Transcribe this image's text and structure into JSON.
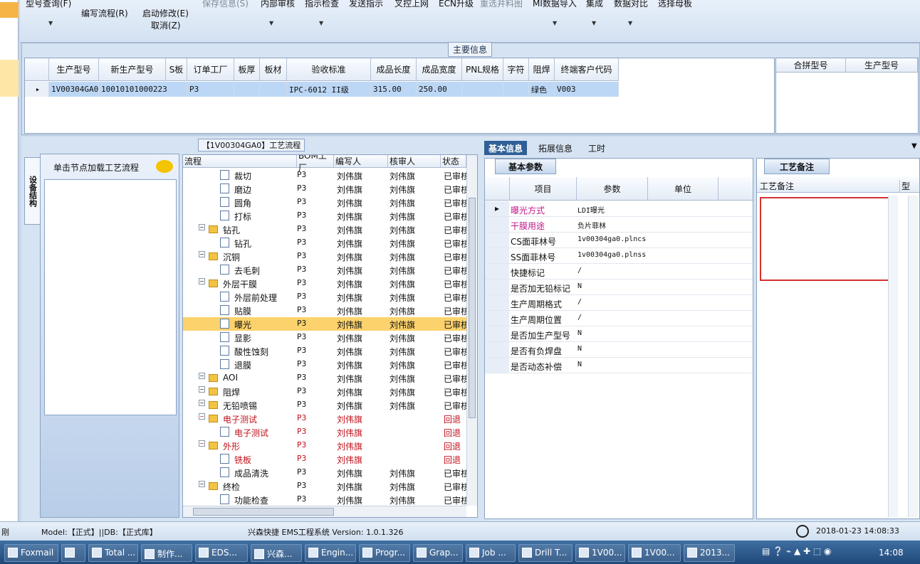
{
  "toolbar": {
    "items": [
      {
        "label": "型号查询(F)",
        "disabled": false
      },
      {
        "label": "编写流程(R)",
        "disabled": false
      },
      {
        "label": "启动修改(E)",
        "disabled": false
      },
      {
        "label": "取消(Z)",
        "disabled": false
      },
      {
        "label": "保存信息(S)",
        "disabled": true
      },
      {
        "label": "内部审核",
        "disabled": false
      },
      {
        "label": "指示检查",
        "disabled": false
      },
      {
        "label": "发送指示",
        "disabled": false
      },
      {
        "label": "叉控上网",
        "disabled": false
      },
      {
        "label": "ECN升级",
        "disabled": false
      },
      {
        "label": "重选并料图",
        "disabled": true
      },
      {
        "label": "MI数据导入",
        "disabled": false
      },
      {
        "label": "集成",
        "disabled": false
      },
      {
        "label": "数据对比",
        "disabled": false
      },
      {
        "label": "选择母板",
        "disabled": false
      }
    ]
  },
  "main_info": {
    "title": "主要信息",
    "columns": [
      "生产型号",
      "新生产型号",
      "S板",
      "订单工厂",
      "板厚",
      "板材",
      "验收标准",
      "成品长度",
      "成品宽度",
      "PNL规格",
      "字符",
      "阻焊",
      "终端客户代码"
    ],
    "row": [
      "1V00304GA0",
      "10010101000223",
      "",
      "P3",
      "",
      "",
      "IPC-6012 II级",
      "315.00",
      "250.00",
      "",
      "",
      "绿色",
      "V003"
    ],
    "merge_columns": [
      "合拼型号",
      "生产型号"
    ]
  },
  "left_panel": {
    "vertical_tab": "设备结构",
    "load_hint": "单击节点加载工艺流程"
  },
  "process": {
    "title": "【1V00304GA0】工艺流程",
    "columns": [
      "流程",
      "BOM工厂",
      "编写人",
      "核审人",
      "状态"
    ],
    "rows": [
      {
        "name": "裁切",
        "level": 2,
        "type": "doc",
        "bom": "P3",
        "writer": "刘伟旗",
        "reviewer": "刘伟旗",
        "status": "已审核",
        "red": false,
        "sel": false
      },
      {
        "name": "磨边",
        "level": 2,
        "type": "doc",
        "bom": "P3",
        "writer": "刘伟旗",
        "reviewer": "刘伟旗",
        "status": "已审核",
        "red": false,
        "sel": false
      },
      {
        "name": "圆角",
        "level": 2,
        "type": "doc",
        "bom": "P3",
        "writer": "刘伟旗",
        "reviewer": "刘伟旗",
        "status": "已审核",
        "red": false,
        "sel": false
      },
      {
        "name": "打标",
        "level": 2,
        "type": "doc",
        "bom": "P3",
        "writer": "刘伟旗",
        "reviewer": "刘伟旗",
        "status": "已审核",
        "red": false,
        "sel": false
      },
      {
        "name": "钻孔",
        "level": 1,
        "type": "fold",
        "bom": "P3",
        "writer": "刘伟旗",
        "reviewer": "刘伟旗",
        "status": "已审核",
        "red": false,
        "sel": false
      },
      {
        "name": "钻孔",
        "level": 2,
        "type": "doc",
        "bom": "P3",
        "writer": "刘伟旗",
        "reviewer": "刘伟旗",
        "status": "已审核",
        "red": false,
        "sel": false
      },
      {
        "name": "沉铜",
        "level": 1,
        "type": "fold",
        "bom": "P3",
        "writer": "刘伟旗",
        "reviewer": "刘伟旗",
        "status": "已审核",
        "red": false,
        "sel": false
      },
      {
        "name": "去毛刺",
        "level": 2,
        "type": "doc",
        "bom": "P3",
        "writer": "刘伟旗",
        "reviewer": "刘伟旗",
        "status": "已审核",
        "red": false,
        "sel": false
      },
      {
        "name": "外层干膜",
        "level": 1,
        "type": "fold",
        "bom": "P3",
        "writer": "刘伟旗",
        "reviewer": "刘伟旗",
        "status": "已审核",
        "red": false,
        "sel": false
      },
      {
        "name": "外层前处理",
        "level": 2,
        "type": "doc",
        "bom": "P3",
        "writer": "刘伟旗",
        "reviewer": "刘伟旗",
        "status": "已审核",
        "red": false,
        "sel": false
      },
      {
        "name": "贴膜",
        "level": 2,
        "type": "doc",
        "bom": "P3",
        "writer": "刘伟旗",
        "reviewer": "刘伟旗",
        "status": "已审核",
        "red": false,
        "sel": false
      },
      {
        "name": "曝光",
        "level": 2,
        "type": "doc",
        "bom": "P3",
        "writer": "刘伟旗",
        "reviewer": "刘伟旗",
        "status": "已审核",
        "red": false,
        "sel": true
      },
      {
        "name": "显影",
        "level": 2,
        "type": "doc",
        "bom": "P3",
        "writer": "刘伟旗",
        "reviewer": "刘伟旗",
        "status": "已审核",
        "red": false,
        "sel": false
      },
      {
        "name": "酸性蚀刻",
        "level": 2,
        "type": "doc",
        "bom": "P3",
        "writer": "刘伟旗",
        "reviewer": "刘伟旗",
        "status": "已审核",
        "red": false,
        "sel": false
      },
      {
        "name": "退膜",
        "level": 2,
        "type": "doc",
        "bom": "P3",
        "writer": "刘伟旗",
        "reviewer": "刘伟旗",
        "status": "已审核",
        "red": false,
        "sel": false
      },
      {
        "name": "AOI",
        "level": 1,
        "type": "fold",
        "bom": "P3",
        "writer": "刘伟旗",
        "reviewer": "刘伟旗",
        "status": "已审核",
        "red": false,
        "sel": false
      },
      {
        "name": "阻焊",
        "level": 1,
        "type": "fold",
        "bom": "P3",
        "writer": "刘伟旗",
        "reviewer": "刘伟旗",
        "status": "已审核",
        "red": false,
        "sel": false
      },
      {
        "name": "无铅喷锡",
        "level": 1,
        "type": "fold",
        "bom": "P3",
        "writer": "刘伟旗",
        "reviewer": "刘伟旗",
        "status": "已审核",
        "red": false,
        "sel": false
      },
      {
        "name": "电子测试",
        "level": 1,
        "type": "fold",
        "bom": "P3",
        "writer": "刘伟旗",
        "reviewer": "",
        "status": "回退",
        "red": true,
        "sel": false
      },
      {
        "name": "电子测试",
        "level": 2,
        "type": "doc",
        "bom": "P3",
        "writer": "刘伟旗",
        "reviewer": "",
        "status": "回退",
        "red": true,
        "sel": false
      },
      {
        "name": "外形",
        "level": 1,
        "type": "fold",
        "bom": "P3",
        "writer": "刘伟旗",
        "reviewer": "",
        "status": "回退",
        "red": true,
        "sel": false
      },
      {
        "name": "铣板",
        "level": 2,
        "type": "doc",
        "bom": "P3",
        "writer": "刘伟旗",
        "reviewer": "",
        "status": "回退",
        "red": true,
        "sel": false
      },
      {
        "name": "成品清洗",
        "level": 2,
        "type": "doc",
        "bom": "P3",
        "writer": "刘伟旗",
        "reviewer": "刘伟旗",
        "status": "已审核",
        "red": false,
        "sel": false
      },
      {
        "name": "终检",
        "level": 1,
        "type": "fold",
        "bom": "P3",
        "writer": "刘伟旗",
        "reviewer": "刘伟旗",
        "status": "已审核",
        "red": false,
        "sel": false
      },
      {
        "name": "功能检查",
        "level": 2,
        "type": "doc",
        "bom": "P3",
        "writer": "刘伟旗",
        "reviewer": "刘伟旗",
        "status": "已审核",
        "red": false,
        "sel": false
      }
    ]
  },
  "right_tabs": [
    "基本信息",
    "拓展信息",
    "工时"
  ],
  "basic": {
    "tab": "基本参数",
    "columns": [
      "项目",
      "参数",
      "单位"
    ],
    "rows": [
      {
        "item": "曝光方式",
        "value": "LDI曝光",
        "unit": "",
        "pink": true
      },
      {
        "item": "干膜用途",
        "value": "负片菲林",
        "unit": "",
        "pink": true
      },
      {
        "item": "CS面菲林号",
        "value": "1v00304ga0.plncs",
        "unit": "",
        "pink": false
      },
      {
        "item": "SS面菲林号",
        "value": "1v00304ga0.plnss",
        "unit": "",
        "pink": false
      },
      {
        "item": "快捷标记",
        "value": "/",
        "unit": "",
        "pink": false
      },
      {
        "item": "是否加无铅标记",
        "value": "N",
        "unit": "",
        "pink": false
      },
      {
        "item": "生产周期格式",
        "value": "/",
        "unit": "",
        "pink": false
      },
      {
        "item": "生产周期位置",
        "value": "/",
        "unit": "",
        "pink": false
      },
      {
        "item": "是否加生产型号",
        "value": "N",
        "unit": "",
        "pink": false
      },
      {
        "item": "是否有负焊盘",
        "value": "N",
        "unit": "",
        "pink": false
      },
      {
        "item": "是否动态补偿",
        "value": "N",
        "unit": "",
        "pink": false
      }
    ]
  },
  "notes": {
    "tab": "工艺备注",
    "col1": "工艺备注",
    "col2": "型"
  },
  "status": {
    "left": "刚",
    "model": "Model:【正式】||DB:【正式库】",
    "app": "兴森快捷 EMS工程系统 Version: 1.0.1.326",
    "datetime": "2018-01-23 14:08:33"
  },
  "taskbar": {
    "items": [
      "Foxmail",
      "",
      "Total ...",
      "制作...",
      "EDS...",
      "兴森...",
      "Engin...",
      "Progr...",
      "Grap...",
      "Job ...",
      "Drill T...",
      "1V00...",
      "1V00...",
      "2013..."
    ],
    "clock": "14:08"
  }
}
